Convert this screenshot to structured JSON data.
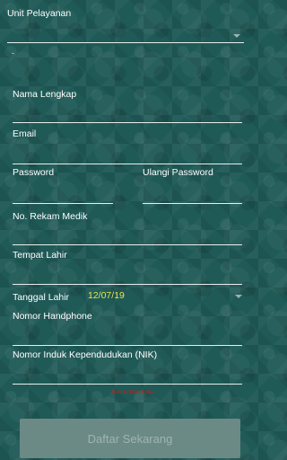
{
  "form": {
    "unit_pelayanan": {
      "label": "Unit Pelayanan",
      "value": ""
    },
    "unit_sub": "-",
    "nama_lengkap": {
      "label": "Nama Lengkap",
      "value": ""
    },
    "email": {
      "label": "Email",
      "value": ""
    },
    "password": {
      "label": "Password",
      "value": ""
    },
    "ulangi_password": {
      "label": "Ulangi Password",
      "value": ""
    },
    "rekam_medik": {
      "label": "No. Rekam Medik",
      "value": ""
    },
    "tempat_lahir": {
      "label": "Tempat Lahir",
      "value": ""
    },
    "tanggal_lahir": {
      "label": "Tanggal Lahir",
      "value": "12/07/19"
    },
    "nomor_hp": {
      "label": "Nomor Handphone",
      "value": ""
    },
    "nik": {
      "label": "Nomor Induk Kependudukan (NIK)",
      "value": ""
    }
  },
  "warning_text": "Data Ini Data Palsu",
  "submit_label": "Daftar Sekarang",
  "colors": {
    "background": "#1f5a57",
    "date_value": "#e6e84a",
    "warning": "#d01818",
    "button_bg": "#6b8a85",
    "button_text": "#9fb4b0"
  }
}
